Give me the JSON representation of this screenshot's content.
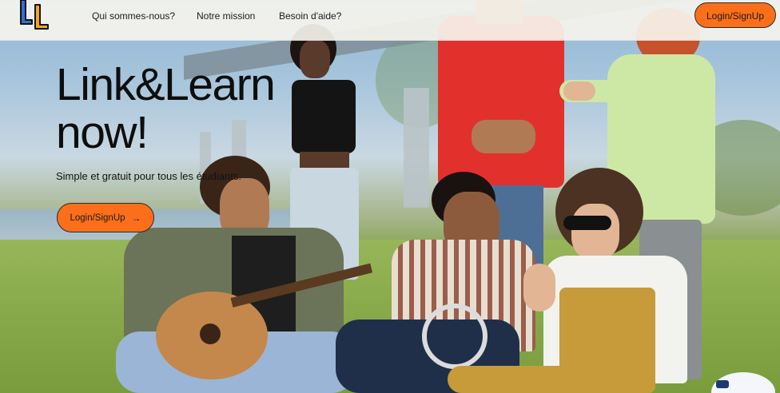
{
  "brand": {
    "logo_letters": "LL",
    "logo_colors": [
      "#2f6fd6",
      "#f5a623"
    ]
  },
  "nav": {
    "links": [
      "Qui sommes-nous?",
      "Notre mission",
      "Besoin d'aide?"
    ],
    "login_label": "Login/SignUp"
  },
  "hero": {
    "headline_line1": "Link&Learn",
    "headline_line2": "now!",
    "subtitle": "Simple et gratuit pour tous les étudiants.",
    "cta_label": "Login/SignUp",
    "cta_icon": "arrow-right-icon"
  },
  "colors": {
    "accent": "#fb6f1a",
    "navbar_bg": "#f6f4ee",
    "text": "#0e0e0e"
  }
}
